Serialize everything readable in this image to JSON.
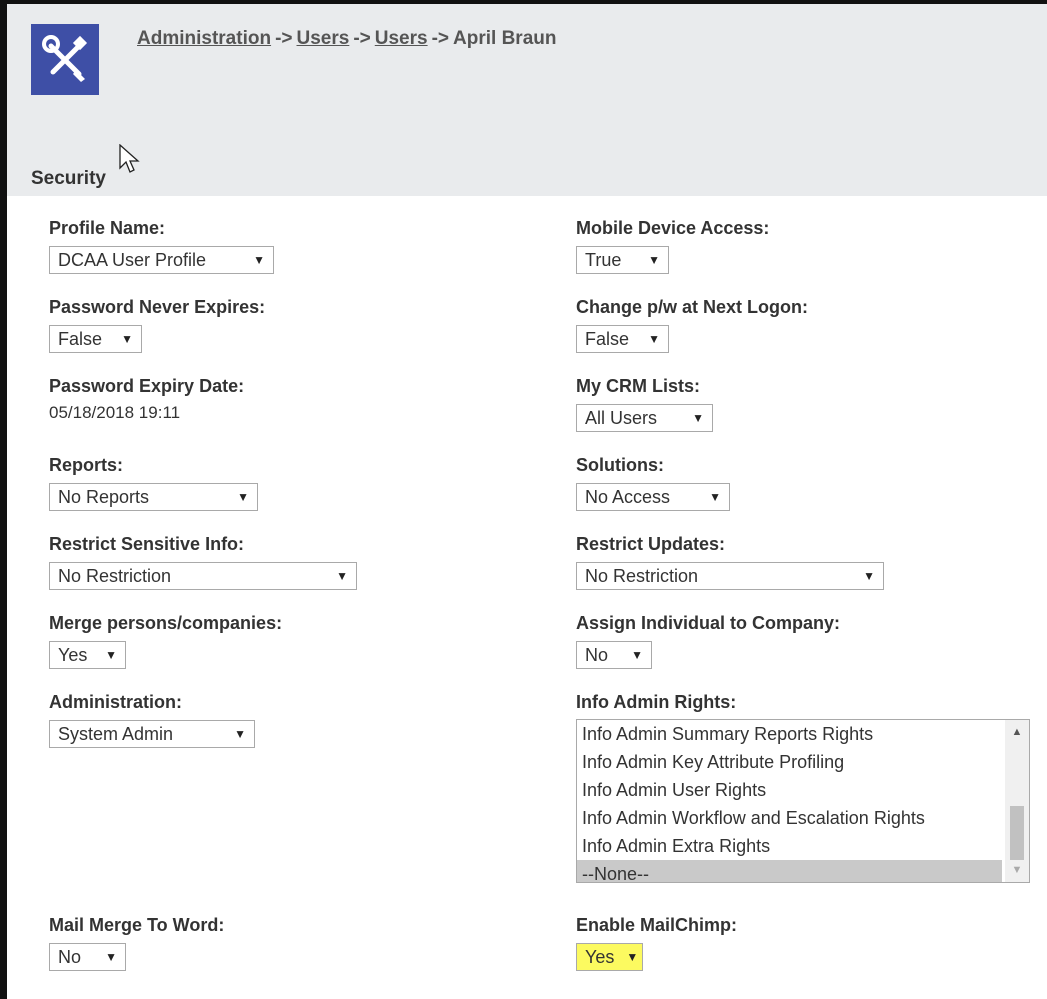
{
  "breadcrumb": {
    "crumbs": [
      "Administration",
      "Users",
      "Users"
    ],
    "current": "April Braun",
    "separator": "->"
  },
  "section_title": "Security",
  "icons": {
    "app": "tools-icon",
    "cursor": "mouse-pointer-icon"
  },
  "colors": {
    "app_icon_bg": "#3e4fa6",
    "header_bg": "#e9ebed",
    "highlight": "#fcfa60"
  },
  "left": {
    "profile_name": {
      "label": "Profile Name:",
      "value": "DCAA User Profile"
    },
    "password_never_expires": {
      "label": "Password Never Expires:",
      "value": "False"
    },
    "password_expiry_date": {
      "label": "Password Expiry Date:",
      "value": "05/18/2018 19:11"
    },
    "reports": {
      "label": "Reports:",
      "value": "No Reports"
    },
    "restrict_sensitive_info": {
      "label": "Restrict Sensitive Info:",
      "value": "No Restriction"
    },
    "merge_persons": {
      "label": "Merge persons/companies:",
      "value": "Yes"
    },
    "administration": {
      "label": "Administration:",
      "value": "System Admin"
    },
    "mail_merge": {
      "label": "Mail Merge To Word:",
      "value": "No"
    }
  },
  "right": {
    "mobile_access": {
      "label": "Mobile Device Access:",
      "value": "True"
    },
    "change_pw": {
      "label": "Change p/w at Next Logon:",
      "value": "False"
    },
    "crm_lists": {
      "label": "My CRM Lists:",
      "value": "All Users"
    },
    "solutions": {
      "label": "Solutions:",
      "value": "No Access"
    },
    "restrict_updates": {
      "label": "Restrict Updates:",
      "value": "No Restriction"
    },
    "assign_individual": {
      "label": "Assign Individual to Company:",
      "value": "No"
    },
    "info_admin_rights": {
      "label": "Info Admin Rights:",
      "options": [
        "Info Admin Summary Reports Rights",
        "Info Admin Key Attribute Profiling",
        "Info Admin User Rights",
        "Info Admin Workflow and Escalation Rights",
        "Info Admin Extra Rights",
        "--None--"
      ],
      "selected": "--None--"
    },
    "enable_mailchimp": {
      "label": "Enable MailChimp:",
      "value": "Yes"
    }
  }
}
